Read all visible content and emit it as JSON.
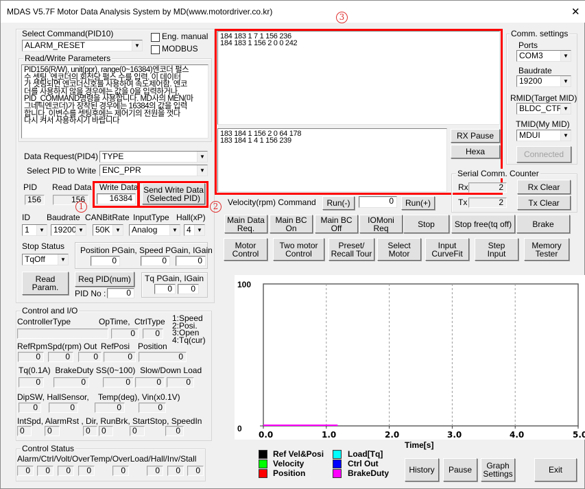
{
  "window": {
    "title": "MDAS V5.7F Motor Data Analysis System by MD(www.motordriver.co.kr)",
    "close": "✕"
  },
  "command": {
    "label": "Select Command(PID10)",
    "value": "ALARM_RESET",
    "eng_manual": "Eng. manual",
    "modbus": "MODBUS"
  },
  "rw": {
    "title": "Read/Write Parameters",
    "desc": "PID156(R/W), unit(ppr), range(0~16384)엔코더 펄스\n수 셋팅. 엔코더의 회전당 펄스 수를 입력. 이 데이터\n가 셋팅되면 엔코더신호를 사용하여 속도제어함. 엔코\n더를 사용하지 않을 경우에는 값을 0을 입력하거나,\nPID_COMMAND명령을 사용합니다. MD사의 MEN(마\n그네틱엔코더)가 장착된 경우에는 16384의 값을 입력\n합니다. 이변수를 셋팅후에는 제어기의 전원을 껏다\n다시 켜서 사용하시기 바랍니다"
  },
  "request": {
    "label": "Data Request(PID4)",
    "value": "TYPE",
    "write_label": "Select PID to Write",
    "write_value": "ENC_PPR"
  },
  "pid": {
    "pid_label": "PID",
    "pid": "156",
    "read_label": "Read Data",
    "read": "156",
    "write_label": "Write Data",
    "write": "16384",
    "send": "Send Write Data\n(Selected PID)"
  },
  "annotations": {
    "one": "1",
    "two": "2",
    "three": "3"
  },
  "params": {
    "id_label": "ID",
    "id": "1",
    "baud_label": "Baudrate",
    "baud": "19200",
    "can_label": "CANBitRate",
    "can": "50K",
    "input_label": "InputType",
    "input": "Analog",
    "hall_label": "Hall(xP)",
    "hall": "4",
    "stop_label": "Stop Status",
    "stop": "TqOff",
    "gain_label": "Position PGain, Speed PGain, IGain",
    "pgain": "0",
    "sgain": "0",
    "igain": "0",
    "read_param": "Read\nParam.",
    "req_pid": "Req PID(num)",
    "pid_no_label": "PID No :",
    "pid_no": "0",
    "tq_label": "Tq PGain, IGain",
    "tq_p": "0",
    "tq_i": "0"
  },
  "io": {
    "title": "Control and I/O",
    "ctrl_type_label": "ControllerType",
    "optime_label": "OpTime,",
    "ctrltype_label": "CtrlType",
    "legend": "1:Speed\n2:Posi.\n3:Open\n4:Tq(cur)",
    "controller": "",
    "optime": "0",
    "ctrltype": "0",
    "row1_labels": [
      "RefRpm",
      "Spd(rpm)",
      "Out",
      "RefPosi",
      "Position"
    ],
    "row1": [
      "0",
      "0",
      "0",
      "0",
      "0"
    ],
    "row2_label": "Tq(0.1A)  BrakeDuty SS(0~100)  Slow/Down Load",
    "row2": [
      "0",
      "0",
      "0",
      "0",
      "0"
    ],
    "row3_label": "DipSW, HallSensor,    Temp(deg), Vin(x0.1V)",
    "row3": [
      "0",
      "0",
      "0",
      "0"
    ],
    "row4_label": "IntSpd, AlarmRst , Dir, RunBrk, StartStop, SpeedIn",
    "row4": [
      "0",
      "0",
      "0",
      "0",
      "0",
      "0"
    ]
  },
  "status": {
    "title": "Control Status",
    "label": "Alarm/Ctrl/Volt/OverTemp/OverLoad/Hall/Inv/Stall",
    "values": [
      "0",
      "0",
      "0",
      "0",
      "0",
      "0",
      "0",
      "0"
    ]
  },
  "tx_log": "184 183 1 7 1 156 236\n184 183 1 156 2 0 0 242",
  "rx_log": "183 184 1 156 2 0 64 178\n183 184 1 4 1 156 239",
  "rx_pause": "RX Pause",
  "hexa": "Hexa",
  "comm": {
    "title": "Comm. settings",
    "ports_label": "Ports",
    "port": "COM3",
    "baud_label": "Baudrate",
    "baud": "19200",
    "rmid_label": "RMID(Target MID)",
    "rmid": "BLDC_CTR",
    "tmid_label": "TMID(My MID)",
    "tmid": "MDUI",
    "connected": "Connected"
  },
  "counter": {
    "title": "Serial Comm. Counter",
    "rx_label": "Rx",
    "rx": "2",
    "tx_label": "Tx",
    "tx": "2",
    "rx_clear": "Rx Clear",
    "tx_clear": "Tx Clear"
  },
  "velocity": {
    "label": "Velocity(rpm) Command",
    "run_minus": "Run(-)",
    "value": "0",
    "run_plus": "Run(+)"
  },
  "buttons1": [
    "Main Data\nReq.",
    "Main BC\nOn",
    "Main BC\nOff",
    "IOMoni\nReq",
    "Stop",
    "Stop free(tq off)",
    "Brake"
  ],
  "buttons2": [
    "Motor\nControl",
    "Two motor\nControl",
    "Preset/\nRecall Tour",
    "Select\nMotor",
    "Input\nCurveFit",
    "Step\nInput",
    "Memory\nTester"
  ],
  "graph": {
    "ymax_label": "100",
    "ymin_label": "0",
    "xticks": [
      "0.0",
      "1.0",
      "2.0",
      "3.0",
      "4.0",
      "5.0"
    ],
    "xlabel": "Time[s]",
    "xlim": [
      0,
      5
    ],
    "ylim": [
      0,
      100
    ],
    "series": [
      {
        "name": "BrakeDuty",
        "color": "#ff00ff",
        "x": [
          0,
          1.18
        ],
        "y": [
          0,
          0
        ]
      }
    ],
    "legend": [
      {
        "name": "Ref Vel&Posi",
        "color": "#000000"
      },
      {
        "name": "Velocity",
        "color": "#00ff00"
      },
      {
        "name": "Position",
        "color": "#ff0000"
      },
      {
        "name": "Load[Tq]",
        "color": "#00ffff"
      },
      {
        "name": "Ctrl Out",
        "color": "#0000ff"
      },
      {
        "name": "BrakeDuty",
        "color": "#ff00ff"
      }
    ]
  },
  "bottom": {
    "history": "History",
    "pause": "Pause",
    "graph_settings": "Graph\nSettings",
    "exit": "Exit"
  }
}
